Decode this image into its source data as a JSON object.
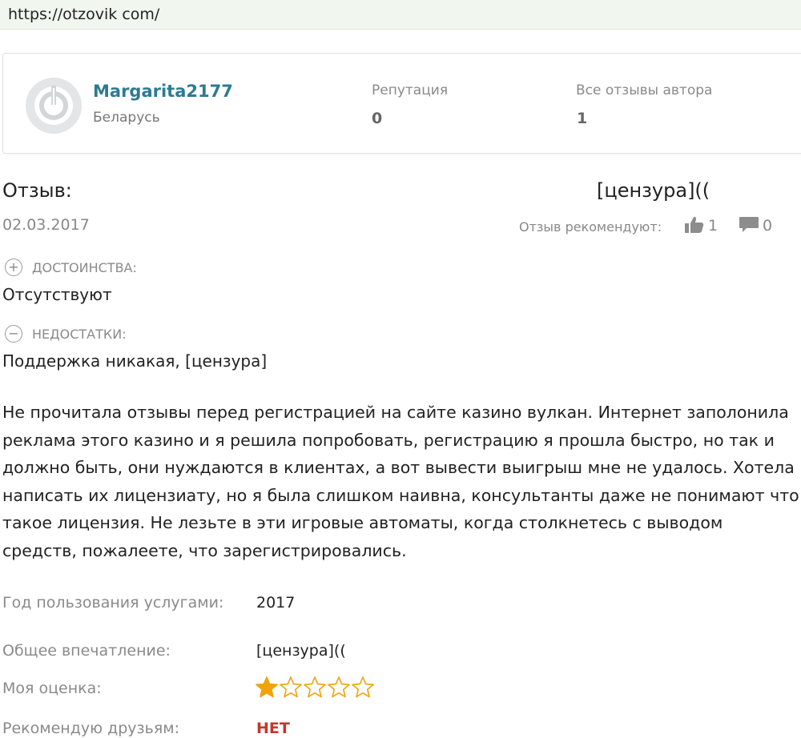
{
  "browser": {
    "url": "https://otzovik com/"
  },
  "author": {
    "name": "Margarita2177",
    "country": "Беларусь",
    "reputation_label": "Репутация",
    "reputation_value": "0",
    "reviews_label": "Все отзывы автора",
    "reviews_value": "1"
  },
  "review": {
    "title_label": "Отзыв:",
    "heading": "[цензура]((",
    "date": "02.03.2017",
    "recommend_label": "Отзыв рекомендуют:",
    "likes": "1",
    "comments": "0",
    "pros_label": "ДОСТОИНСТВА:",
    "pros_text": "Отсутствуют",
    "cons_label": "НЕДОСТАТКИ:",
    "cons_text": "Поддержка никакая, [цензура]",
    "body": "Не прочитала отзывы перед регистрацией на сайте казино вулкан. Интернет заполонила реклама этого казино и я решила попробовать, регистрацию я прошла быстро, но так и должно быть, они нуждаются в клиентах, а вот вывести выигрыш мне не удалось. Хотела написать их лицензиату, но я была слишком наивна, консультанты даже не понимают что такое лицензия. Не лезьте в эти игровые автоматы, когда столкнетесь с выводом средств, пожалеете, что зарегистрировались."
  },
  "properties": {
    "year_label": "Год пользования услугами:",
    "year_value": "2017",
    "impression_label": "Общее впечатление:",
    "impression_value": "[цензура]((",
    "rating_label": "Моя оценка:",
    "rating_value": 1,
    "rating_max": 5,
    "recommend_label": "Рекомендую друзьям:",
    "recommend_value": "НЕТ"
  },
  "colors": {
    "author_link": "#2d7a93",
    "star_filled": "#f0a30a",
    "no_red": "#c0392b"
  }
}
